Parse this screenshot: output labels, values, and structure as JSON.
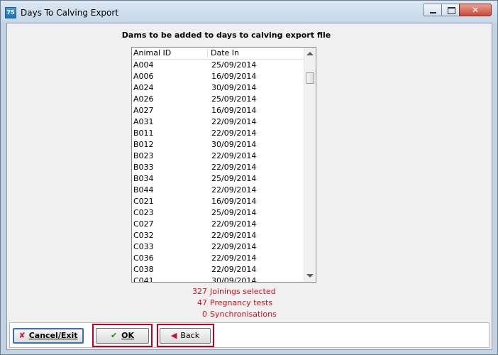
{
  "window": {
    "title": "Days To Calving Export",
    "icon": "app-icon",
    "controls": [
      "minimize-icon",
      "maximize-icon",
      "close-icon"
    ]
  },
  "heading": "Dams to be added to days to calving export file",
  "list": {
    "columns": [
      "Animal ID",
      "Date In"
    ],
    "rows": [
      [
        "A004",
        "25/09/2014"
      ],
      [
        "A006",
        "16/09/2014"
      ],
      [
        "A024",
        "30/09/2014"
      ],
      [
        "A026",
        "25/09/2014"
      ],
      [
        "A027",
        "16/09/2014"
      ],
      [
        "A031",
        "22/09/2014"
      ],
      [
        "B011",
        "22/09/2014"
      ],
      [
        "B012",
        "30/09/2014"
      ],
      [
        "B023",
        "22/09/2014"
      ],
      [
        "B033",
        "22/09/2014"
      ],
      [
        "B034",
        "25/09/2014"
      ],
      [
        "B044",
        "22/09/2014"
      ],
      [
        "C021",
        "16/09/2014"
      ],
      [
        "C023",
        "25/09/2014"
      ],
      [
        "C027",
        "22/09/2014"
      ],
      [
        "C032",
        "22/09/2014"
      ],
      [
        "C033",
        "22/09/2014"
      ],
      [
        "C036",
        "22/09/2014"
      ],
      [
        "C038",
        "22/09/2014"
      ],
      [
        "C041",
        "30/09/2014"
      ]
    ]
  },
  "stats": [
    {
      "count": "327",
      "label": "Joinings selected"
    },
    {
      "count": "47",
      "label": "Pregnancy tests"
    },
    {
      "count": "0",
      "label": "Synchronisations"
    }
  ],
  "buttons": {
    "cancel": "Cancel/Exit",
    "ok": "OK",
    "back": "Back"
  },
  "colors": {
    "stats_text": "#d0121b",
    "highlight": "#c3001f"
  }
}
